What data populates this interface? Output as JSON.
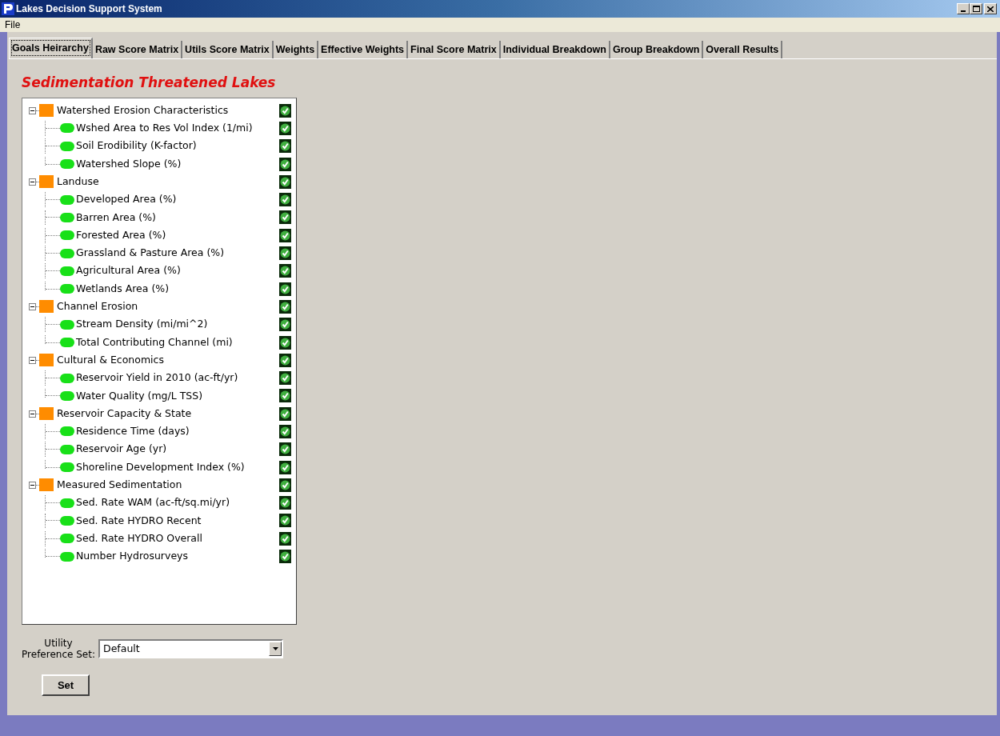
{
  "window": {
    "title": "Lakes Decision Support System"
  },
  "menu": [
    "File"
  ],
  "tabs": [
    {
      "label": "Goals Heirarchy",
      "selected": true
    },
    {
      "label": "Raw Score Matrix",
      "selected": false
    },
    {
      "label": "Utils Score Matrix",
      "selected": false
    },
    {
      "label": "Weights",
      "selected": false
    },
    {
      "label": "Effective Weights",
      "selected": false
    },
    {
      "label": "Final Score Matrix",
      "selected": false
    },
    {
      "label": "Individual Breakdown",
      "selected": false
    },
    {
      "label": "Group Breakdown",
      "selected": false
    },
    {
      "label": "Overall Results",
      "selected": false
    }
  ],
  "heading": "Sedimentation Threatened Lakes",
  "tree": [
    {
      "label": "Watershed Erosion Characteristics",
      "checked": true,
      "expanded": true,
      "children": [
        {
          "label": "Wshed Area to Res Vol Index (1/mi)",
          "checked": true
        },
        {
          "label": "Soil Erodibility (K-factor)",
          "checked": true
        },
        {
          "label": "Watershed Slope (%)",
          "checked": true
        }
      ]
    },
    {
      "label": "Landuse",
      "checked": true,
      "expanded": true,
      "children": [
        {
          "label": "Developed Area (%)",
          "checked": true
        },
        {
          "label": "Barren Area (%)",
          "checked": true
        },
        {
          "label": "Forested Area (%)",
          "checked": true
        },
        {
          "label": "Grassland & Pasture Area (%)",
          "checked": true
        },
        {
          "label": "Agricultural Area (%)",
          "checked": true
        },
        {
          "label": "Wetlands Area (%)",
          "checked": true
        }
      ]
    },
    {
      "label": "Channel Erosion",
      "checked": true,
      "expanded": true,
      "children": [
        {
          "label": "Stream Density (mi/mi^2)",
          "checked": true
        },
        {
          "label": "Total Contributing Channel (mi)",
          "checked": true
        }
      ]
    },
    {
      "label": "Cultural & Economics",
      "checked": true,
      "expanded": true,
      "children": [
        {
          "label": "Reservoir Yield in 2010 (ac-ft/yr)",
          "checked": true
        },
        {
          "label": "Water Quality (mg/L TSS)",
          "checked": true
        }
      ]
    },
    {
      "label": "Reservoir Capacity & State",
      "checked": true,
      "expanded": true,
      "children": [
        {
          "label": "Residence Time (days)",
          "checked": true
        },
        {
          "label": "Reservoir Age (yr)",
          "checked": true
        },
        {
          "label": "Shoreline Development Index (%)",
          "checked": true
        }
      ]
    },
    {
      "label": "Measured Sedimentation",
      "checked": true,
      "expanded": true,
      "children": [
        {
          "label": "Sed. Rate WAM (ac-ft/sq.mi/yr)",
          "checked": true
        },
        {
          "label": "Sed. Rate HYDRO Recent",
          "checked": true
        },
        {
          "label": "Sed. Rate HYDRO Overall",
          "checked": true
        },
        {
          "label": "Number Hydrosurveys",
          "checked": true
        }
      ]
    }
  ],
  "preference": {
    "label": "Utility Preference Set:",
    "value": "Default"
  },
  "set_button": "Set"
}
